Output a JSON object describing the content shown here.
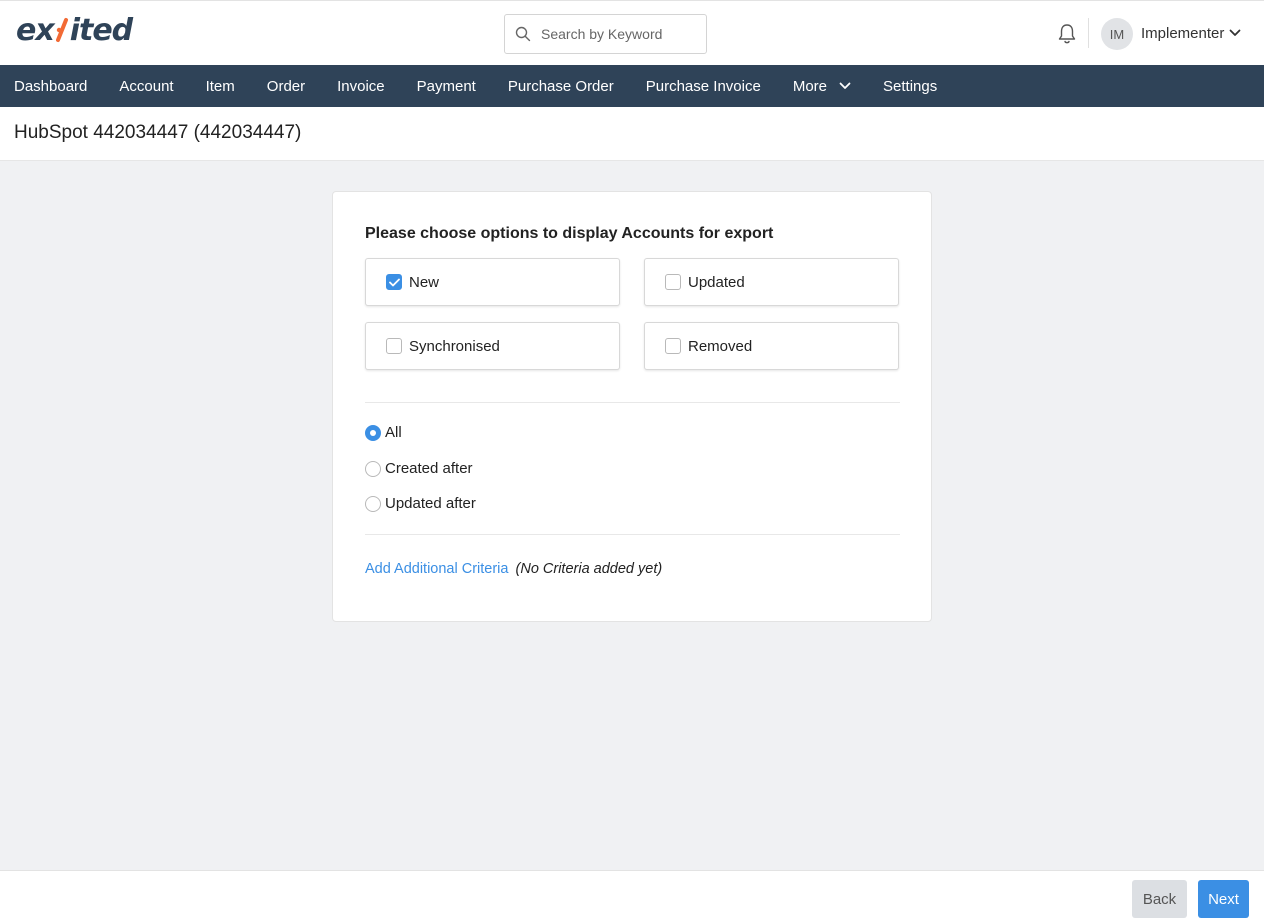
{
  "app": {
    "logo_text_left": "ex",
    "logo_text_right": "ited",
    "logo_colors": {
      "primary": "#2f4358",
      "accent": "#f26a35"
    }
  },
  "header": {
    "search": {
      "placeholder": "Search by Keyword",
      "value": ""
    },
    "notification_icon": "bell-icon",
    "user": {
      "initials": "IM",
      "name": "Implementer"
    }
  },
  "nav": {
    "items": [
      {
        "label": "Dashboard"
      },
      {
        "label": "Account"
      },
      {
        "label": "Item"
      },
      {
        "label": "Order"
      },
      {
        "label": "Invoice"
      },
      {
        "label": "Payment"
      },
      {
        "label": "Purchase Order"
      },
      {
        "label": "Purchase Invoice"
      },
      {
        "label": "More"
      },
      {
        "label": "Settings"
      }
    ],
    "background": "#2f4358"
  },
  "page": {
    "title": "HubSpot 442034447 (442034447)"
  },
  "card": {
    "heading": "Please choose options to display Accounts for export",
    "checkboxes": [
      {
        "label": "New",
        "checked": true
      },
      {
        "label": "Updated",
        "checked": false
      },
      {
        "label": "Synchronised",
        "checked": false
      },
      {
        "label": "Removed",
        "checked": false
      }
    ],
    "radios": [
      {
        "label": "All",
        "checked": true
      },
      {
        "label": "Created after",
        "checked": false
      },
      {
        "label": "Updated after",
        "checked": false
      }
    ],
    "criteria_link": "Add Additional Criteria",
    "criteria_note": "(No Criteria added yet)"
  },
  "footer": {
    "back_label": "Back",
    "next_label": "Next"
  },
  "colors": {
    "accent": "#3b8fe4",
    "page_bg": "#f0f1f3"
  }
}
